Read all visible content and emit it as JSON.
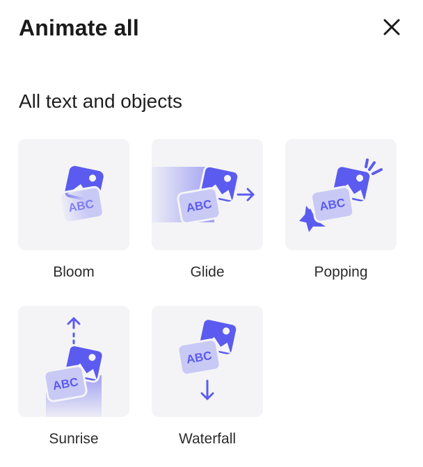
{
  "header": {
    "title": "Animate all"
  },
  "section": {
    "title": "All text and objects"
  },
  "effects": [
    {
      "label": "Bloom",
      "icon": "bloom-icon"
    },
    {
      "label": "Glide",
      "icon": "glide-icon"
    },
    {
      "label": "Popping",
      "icon": "popping-icon"
    },
    {
      "label": "Sunrise",
      "icon": "sunrise-icon"
    },
    {
      "label": "Waterfall",
      "icon": "waterfall-icon"
    }
  ],
  "badge_text": "ABC",
  "colors": {
    "accent": "#5b5bf0",
    "accent_light": "#c9c9f6",
    "tile_bg": "#f4f4f6"
  }
}
